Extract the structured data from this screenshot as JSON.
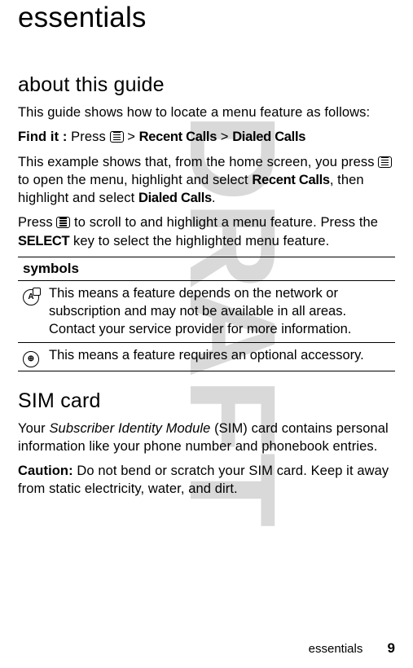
{
  "watermark": "DRAFT",
  "title": "essentials",
  "section1": {
    "heading": "about this guide",
    "p1": "This guide shows how to locate a menu feature as follows:",
    "findit_label": "Find it :",
    "findit_press": " Press ",
    "findit_gt1": " > ",
    "findit_recent": "Recent Calls",
    "findit_gt2": " > ",
    "findit_dialed": "Dialed Calls",
    "p2a": "This example shows that, from the home screen, you press ",
    "p2b": " to open the menu, highlight and select ",
    "p2_recent": "Recent Calls",
    "p2c": ", then highlight and select ",
    "p2_dialed": "Dialed Calls",
    "p2d": ".",
    "p3a": "Press ",
    "p3b": " to scroll to and highlight a menu feature. Press the ",
    "p3_select": "SELECT",
    "p3c": " key to select the highlighted menu feature."
  },
  "symbols_table": {
    "header": "symbols",
    "row1": "This means a feature depends on the network or subscription and may not be available in all areas. Contact your service provider for more information.",
    "row2": "This means a feature requires an optional accessory."
  },
  "section2": {
    "heading": "SIM card",
    "p1a": "Your ",
    "p1_em": "Subscriber Identity Module",
    "p1b": " (SIM) card contains personal information like your phone number and phonebook entries.",
    "p2_label": "Caution:",
    "p2": " Do not bend or scratch your SIM card. Keep it away from static electricity, water, and dirt."
  },
  "footer": {
    "label": "essentials",
    "page": "9"
  }
}
